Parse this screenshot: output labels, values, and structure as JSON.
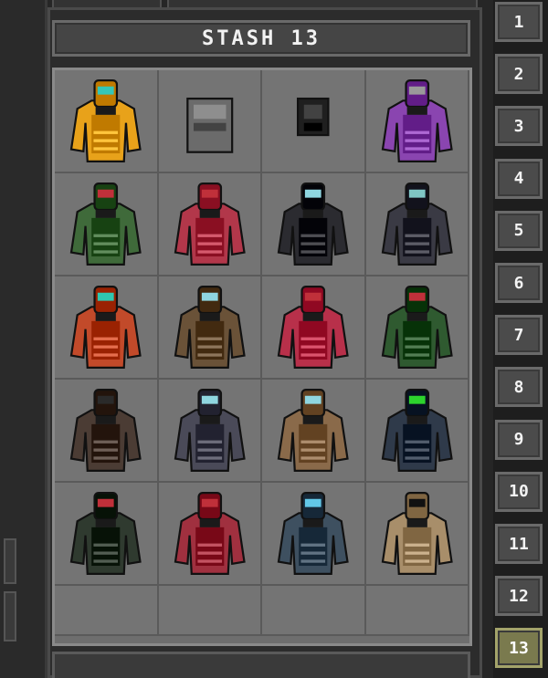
{
  "stash": {
    "title": "STASH 13",
    "active_tab": "13",
    "columns": 4,
    "rows": 6
  },
  "tabs": [
    {
      "label": "1",
      "active": false
    },
    {
      "label": "2",
      "active": false
    },
    {
      "label": "3",
      "active": false
    },
    {
      "label": "4",
      "active": false
    },
    {
      "label": "5",
      "active": false
    },
    {
      "label": "6",
      "active": false
    },
    {
      "label": "7",
      "active": false
    },
    {
      "label": "8",
      "active": false
    },
    {
      "label": "9",
      "active": false
    },
    {
      "label": "10",
      "active": false
    },
    {
      "label": "11",
      "active": false
    },
    {
      "label": "12",
      "active": false
    },
    {
      "label": "13",
      "active": true
    }
  ],
  "items": [
    {
      "icon": "yellow-hazmat-suit-icon",
      "color": "#e8a21a",
      "visor": "#34c7b7"
    },
    {
      "icon": "grey-plate-vest-icon",
      "color": "#6b6b6b",
      "visor": null
    },
    {
      "icon": "black-vest-icon",
      "color": "#1f1f1f",
      "visor": null
    },
    {
      "icon": "purple-suit-icon",
      "color": "#8a45b0",
      "visor": "#9a9a9a"
    },
    {
      "icon": "green-armor-icon",
      "color": "#3f6a3a",
      "visor": "#c0303a"
    },
    {
      "icon": "red-armor-icon",
      "color": "#b2374a",
      "visor": "#c0303a"
    },
    {
      "icon": "black-police-armor-icon",
      "color": "#2b2b30",
      "visor": "#8fd6e0"
    },
    {
      "icon": "dark-grey-armor-icon",
      "color": "#3a3a44",
      "visor": "#7fc6c4"
    },
    {
      "icon": "orange-suit-icon",
      "color": "#c24a2a",
      "visor": "#2fc7b0"
    },
    {
      "icon": "brown-armor-icon",
      "color": "#6a5238",
      "visor": "#8fd6e0"
    },
    {
      "icon": "red-skull-armor-icon",
      "color": "#b8304a",
      "visor": "#c0303a"
    },
    {
      "icon": "green-heavy-armor-icon",
      "color": "#2f5a30",
      "visor": "#c0303a"
    },
    {
      "icon": "dark-bronze-armor-icon",
      "color": "#4b3c34",
      "visor": "#2a2a2a"
    },
    {
      "icon": "slate-armor-icon",
      "color": "#4a4a58",
      "visor": "#8fd6e0"
    },
    {
      "icon": "tan-shoulder-armor-icon",
      "color": "#8a6a4a",
      "visor": "#8fd6e0"
    },
    {
      "icon": "navy-armor-icon",
      "color": "#2f3a4a",
      "visor": "#2dd42d"
    },
    {
      "icon": "camo-armor-icon",
      "color": "#2f3a2f",
      "visor": "#c0303a"
    },
    {
      "icon": "crimson-shoulder-armor-icon",
      "color": "#a0303f",
      "visor": "#c0303a"
    },
    {
      "icon": "blue-hooded-armor-icon",
      "color": "#3e5060",
      "visor": "#62c8e8"
    },
    {
      "icon": "tan-k-armor-icon",
      "color": "#a88e6a",
      "visor": "#111111"
    }
  ]
}
